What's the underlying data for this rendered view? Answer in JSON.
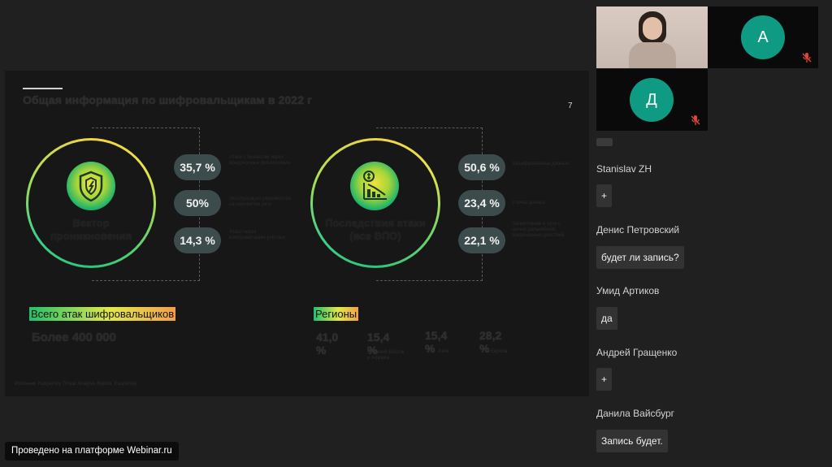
{
  "slide": {
    "title": "Общая информация по шифровальщикам в 2022 г",
    "page_number": "7",
    "left_ring": {
      "label": "Вектор проникновения",
      "items": [
        {
          "value": "35,7 %",
          "note": "Атаки с бизнесом через вредоносные фишинговые"
        },
        {
          "value": "50%",
          "note": "Эксплуатация уязвимостей на периметре сети"
        },
        {
          "value": "14,3 %",
          "note": "Атаки через компрометацию учётных"
        }
      ]
    },
    "right_ring": {
      "label": "Последствия атаки (все ВПО)",
      "items": [
        {
          "value": "50,6 %",
          "note": "Зашифрованные данные"
        },
        {
          "value": "23,4 %",
          "note": "Утечка данных"
        },
        {
          "value": "22,1 %",
          "note": "Закрепление в сети с целью дальнейших вредоносных действий"
        }
      ]
    },
    "total_heading": "Всего атак шифровальщиков",
    "total_value": "Более 400 000",
    "regions_heading": "Регионы",
    "regions": [
      {
        "value": "41,0 %",
        "note": ""
      },
      {
        "value": "15,4 %",
        "note": "Ближний Восток и Африка"
      },
      {
        "value": "15,4 %",
        "note": "Азия"
      },
      {
        "value": "28,2 %",
        "note": "Европа"
      }
    ],
    "source": "Источник: Kaspersky Threat Analysis Report, Kaspersky"
  },
  "badge": "Проведено на платформе Webinar.ru",
  "participants": [
    {
      "initial": "",
      "type": "video"
    },
    {
      "initial": "А",
      "muted": true
    },
    {
      "initial": "Д",
      "muted": true
    }
  ],
  "chat": [
    {
      "name": "Stanislav ZH",
      "message": "+"
    },
    {
      "name": "Денис Петровский",
      "message": "будет ли запись?"
    },
    {
      "name": "Умид Артиков",
      "message": "да"
    },
    {
      "name": "Андрей Гращенко",
      "message": "+"
    },
    {
      "name": "Данила Вайсбург",
      "message": "Запись будет."
    }
  ],
  "colors": {
    "avatar": "#0f9b83",
    "mic_muted": "#e0443a",
    "background": "#202020"
  }
}
